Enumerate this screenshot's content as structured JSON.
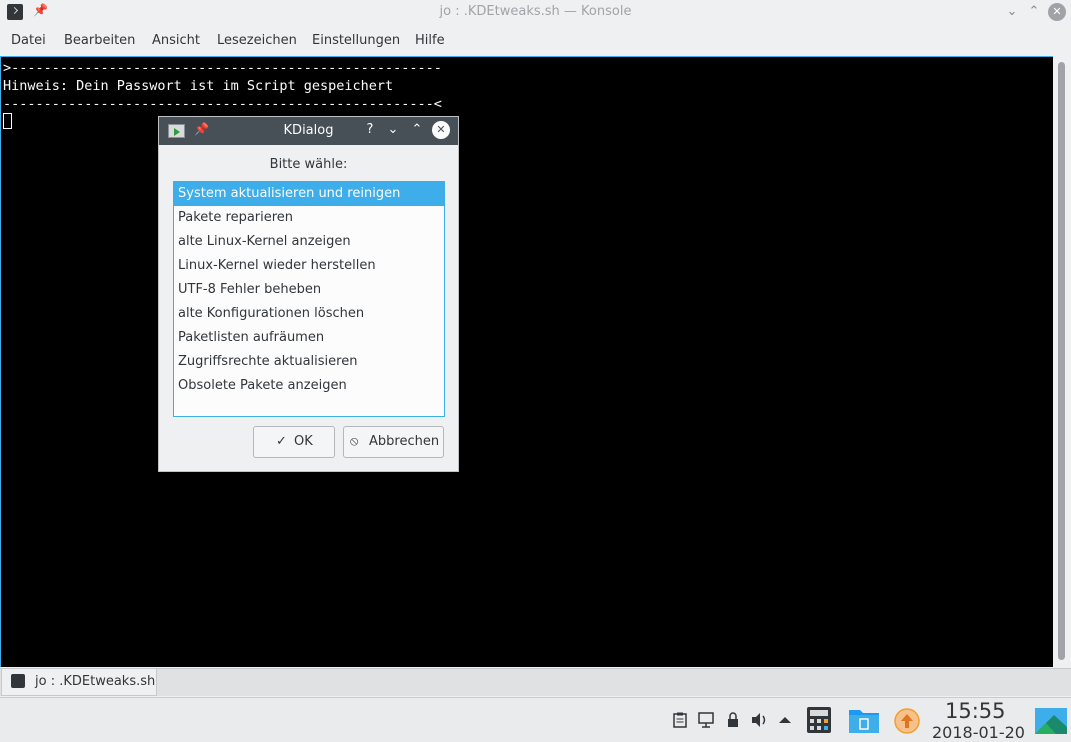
{
  "window": {
    "title": "jo : .KDEtweaks.sh — Konsole",
    "minimize": "⌄",
    "maximize": "⌃",
    "close": "✕"
  },
  "menubar": {
    "items": [
      "Datei",
      "Bearbeiten",
      "Ansicht",
      "Lesezeichen",
      "Einstellungen",
      "Hilfe"
    ]
  },
  "terminal": {
    "line1": ">-----------------------------------------------------",
    "line2": "Hinweis: Dein Passwort ist im Script gespeichert",
    "line3": "-----------------------------------------------------<"
  },
  "tab": {
    "label": "jo : .KDEtweaks.sh"
  },
  "dialog": {
    "title": "KDialog",
    "help": "?",
    "prompt": "Bitte wähle:",
    "items": [
      "System aktualisieren und reinigen",
      "Pakete reparieren",
      "alte Linux-Kernel anzeigen",
      "Linux-Kernel wieder herstellen",
      "UTF-8 Fehler beheben",
      "alte Konfigurationen löschen",
      "Paketlisten aufräumen",
      "Zugriffsrechte aktualisieren",
      "Obsolete Pakete anzeigen"
    ],
    "selected_index": 0,
    "ok_label": "OK",
    "cancel_label": "Abbrechen"
  },
  "panel": {
    "time": "15:55",
    "date": "2018-01-20"
  },
  "colors": {
    "accent": "#3daee9",
    "dialog_titlebar": "#475057",
    "terminal_bg": "#000000",
    "update_notifier": "#f0a030"
  }
}
